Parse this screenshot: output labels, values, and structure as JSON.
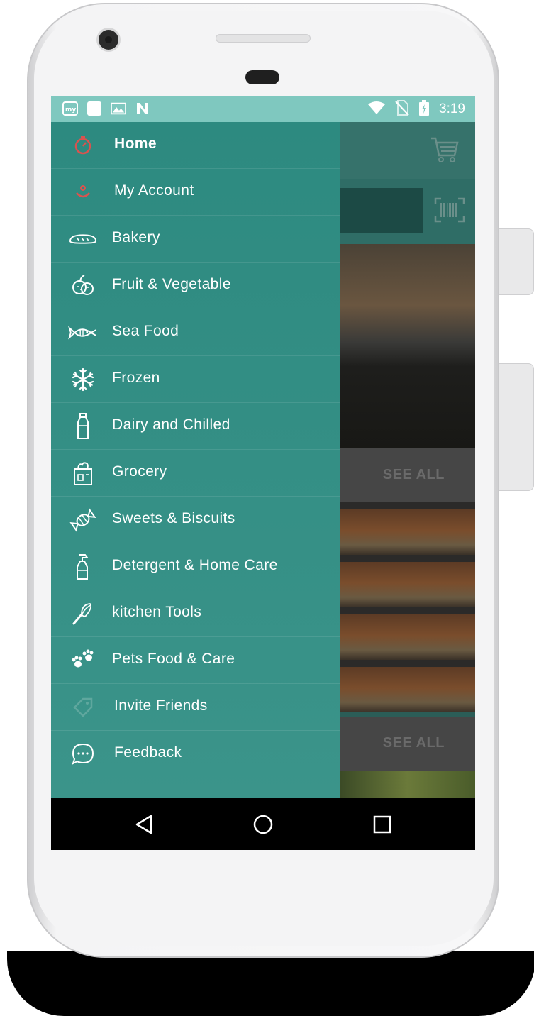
{
  "status_bar": {
    "time": "3:19",
    "left_icons": [
      "mytaxi-icon",
      "square-notification-icon",
      "gallery-icon",
      "n-app-icon"
    ],
    "right_icons": [
      "wifi-icon",
      "no-sim-icon",
      "battery-icon"
    ]
  },
  "drawer": {
    "items": [
      {
        "label": "Home",
        "icon": "home-timer-icon"
      },
      {
        "label": "My Account",
        "icon": "account-icon"
      },
      {
        "label": "Bakery",
        "icon": "bread-icon"
      },
      {
        "label": "Fruit & Vegetable",
        "icon": "fruit-icon"
      },
      {
        "label": "Sea Food",
        "icon": "fish-icon"
      },
      {
        "label": "Frozen",
        "icon": "snowflake-icon"
      },
      {
        "label": "Dairy and Chilled",
        "icon": "milk-bottle-icon"
      },
      {
        "label": "Grocery",
        "icon": "grocery-bag-icon"
      },
      {
        "label": "Sweets & Biscuits",
        "icon": "candy-icon"
      },
      {
        "label": "Detergent & Home Care",
        "icon": "spray-bottle-icon"
      },
      {
        "label": "kitchen Tools",
        "icon": "whisk-icon"
      },
      {
        "label": "Pets Food & Care",
        "icon": "paw-icon"
      },
      {
        "label": "Invite Friends",
        "icon": "tag-icon"
      },
      {
        "label": "Feedback",
        "icon": "chat-bubble-icon"
      }
    ]
  },
  "background_app": {
    "see_all_1": "SEE ALL",
    "see_all_2": "SEE ALL",
    "icons": [
      "cart-icon",
      "barcode-icon"
    ]
  },
  "nav_bar": {
    "icons": [
      "back-icon",
      "home-circle-icon",
      "recents-icon"
    ]
  },
  "colors": {
    "status_bar": "#7fc8bf",
    "drawer": "#3b948a",
    "accent_red": "#d9534f"
  }
}
